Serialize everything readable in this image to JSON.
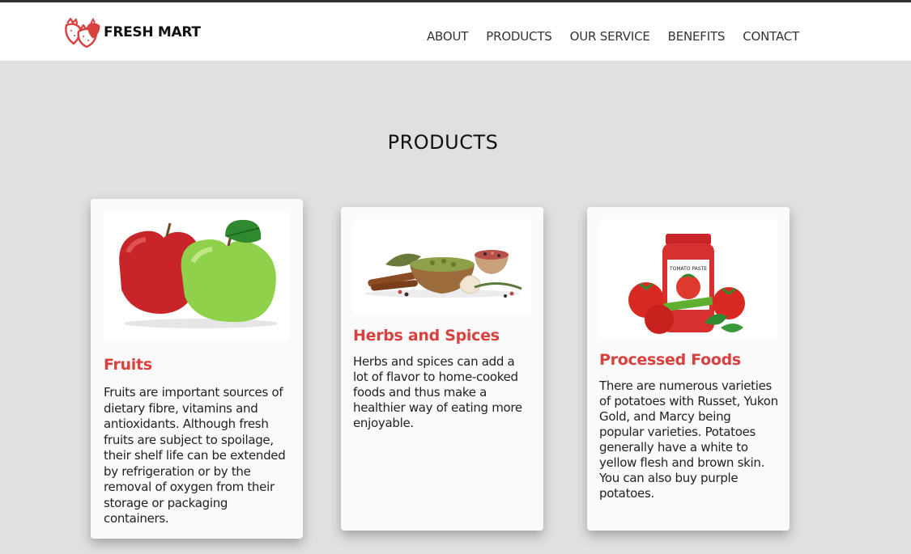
{
  "header": {
    "logo_text": "FRESH MART",
    "logo_icon": "strawberry-icon",
    "nav": [
      "ABOUT",
      "PRODUCTS",
      "OUR SERVICE",
      "BENEFITS",
      "CONTACT"
    ]
  },
  "section": {
    "title": "PRODUCTS"
  },
  "cards": [
    {
      "title": "Fruits",
      "image": "apples-image",
      "text": "Fruits are important sources of dietary fibre, vitamins and antioxidants. Although fresh fruits are subject to spoilage, their shelf life can be extended by refrigeration or by the removal of oxygen from their storage or packaging containers."
    },
    {
      "title": "Herbs and Spices",
      "image": "spices-image",
      "text": "Herbs and spices can add a lot of flavor to home-cooked foods and thus make a healthier way of eating more enjoyable."
    },
    {
      "title": "Processed Foods",
      "image": "tomato-paste-image",
      "text": "There are numerous varieties of potatoes with Russet, Yukon Gold, and Marcy being popular varieties. Potatoes generally have a white to yellow flesh and brown skin. You can also buy purple potatoes."
    }
  ],
  "colors": {
    "accent": "#d9413f",
    "background": "#e0e0e0",
    "header_bg": "#ffffff"
  }
}
